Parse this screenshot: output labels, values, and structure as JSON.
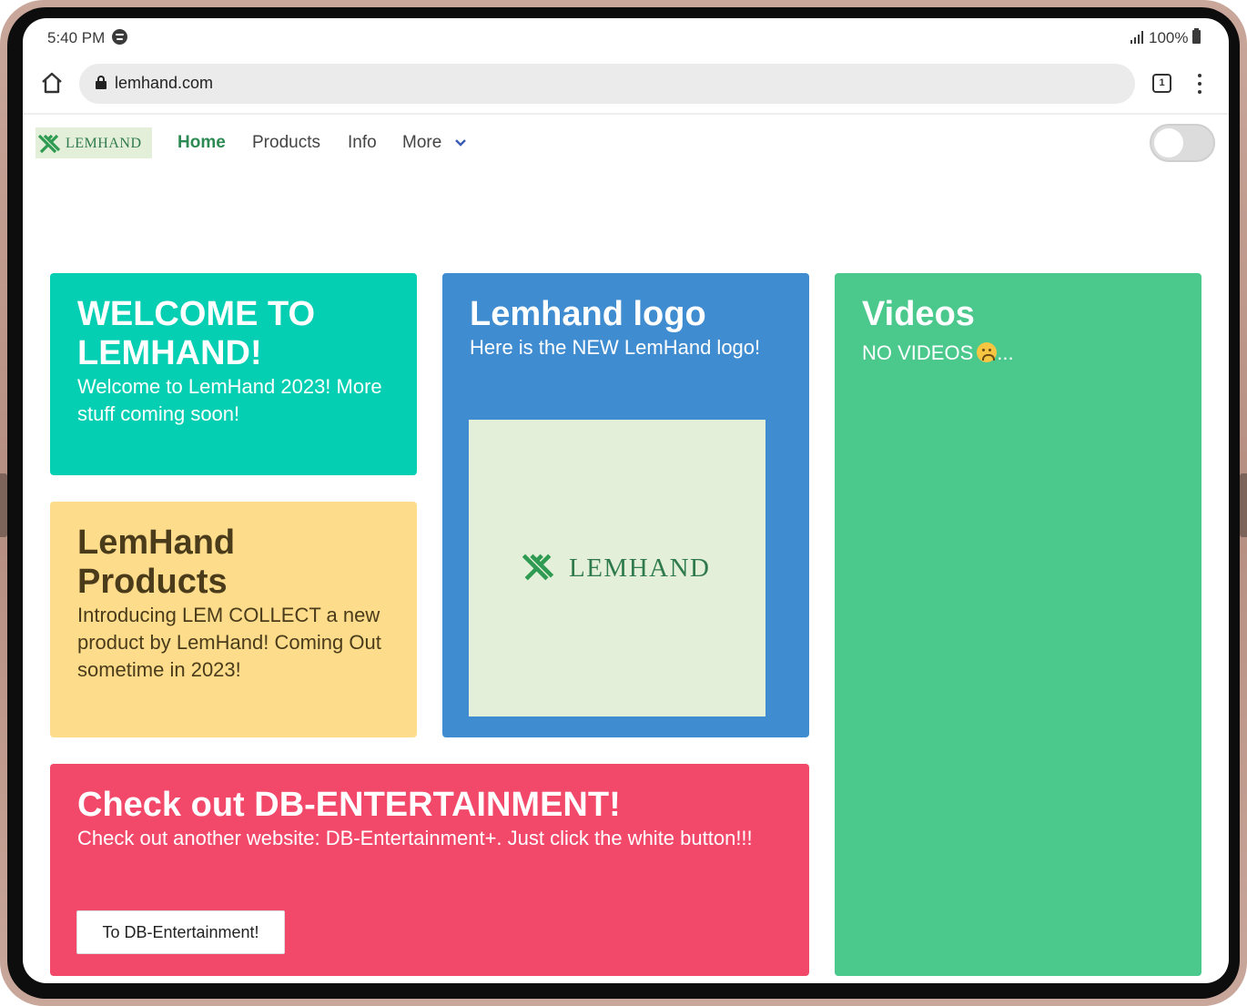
{
  "status_bar": {
    "time": "5:40 PM",
    "battery": "100%",
    "icons": [
      "spotify-icon",
      "signal-icon",
      "battery-icon"
    ]
  },
  "browser": {
    "url": "lemhand.com",
    "tab_count": "1",
    "icons": [
      "home-icon",
      "lock-icon",
      "tabs-icon",
      "menu-icon"
    ]
  },
  "nav": {
    "logo_text": "LEMHAND",
    "links": [
      "Home",
      "Products",
      "Info",
      "More"
    ],
    "active_link": "Home",
    "toggle_on": false
  },
  "cards": {
    "welcome": {
      "title": "WELCOME TO LEMHAND!",
      "text": "Welcome to LemHand 2023! More stuff coming soon!"
    },
    "products": {
      "title": "LemHand Products",
      "text": "Introducing LEM COLLECT a new product by LemHand! Coming Out sometime in 2023!"
    },
    "logo": {
      "title": "Lemhand logo",
      "text": "Here is the NEW LemHand logo!",
      "logo_text": "LEMHAND"
    },
    "videos": {
      "title": "Videos",
      "text_before": "NO VIDEOS",
      "text_after": "..."
    },
    "db": {
      "title": "Check out DB-ENTERTAINMENT!",
      "text": "Check out another website: DB-Entertainment+. Just click the white button!!!",
      "button_label": "To DB-Entertainment!"
    }
  },
  "colors": {
    "welcome": "#04cfb3",
    "products": "#fddd8b",
    "logo": "#3f8cd1",
    "videos": "#4bc98d",
    "db": "#f2486a",
    "brand_green": "#2f7a4d"
  }
}
